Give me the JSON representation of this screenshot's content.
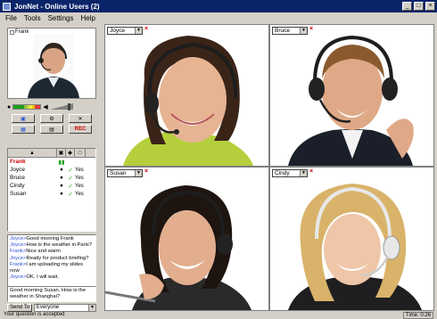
{
  "window": {
    "title": "JonNet - Online Users (2)"
  },
  "menu": [
    "File",
    "Tools",
    "Settings",
    "Help"
  ],
  "self": {
    "name": "Frank"
  },
  "controls": {
    "rec_label": "REC"
  },
  "users": [
    {
      "name": "Frank",
      "yes": ""
    },
    {
      "name": "Joyce",
      "yes": "Yes"
    },
    {
      "name": "Bruce",
      "yes": "Yes"
    },
    {
      "name": "Cindy",
      "yes": "Yes"
    },
    {
      "name": "Susan",
      "yes": "Yes"
    }
  ],
  "chat": [
    {
      "who": "Joyce>",
      "msg": "Good morning Frank"
    },
    {
      "who": "Joyce>",
      "msg": "How is the weather in Paris?"
    },
    {
      "who": "Frank>",
      "msg": "Nice and warm"
    },
    {
      "who": "Joyce>",
      "msg": "Ready for product briefing?"
    },
    {
      "who": "Frank>",
      "msg": "I am uploading my slides now"
    },
    {
      "who": "Joyce>",
      "msg": "OK. I will wait."
    }
  ],
  "chat_input": "Good morning Susan. How is the weather in Shanghai?",
  "send": {
    "label": "Send To",
    "target": "Everyone"
  },
  "videos": [
    {
      "label": "Joyce"
    },
    {
      "label": "Bruce"
    },
    {
      "label": "Susan"
    },
    {
      "label": "Cindy"
    }
  ],
  "status": {
    "left": "Your question is accepted",
    "right": "Time: 0:26"
  },
  "colors": {
    "title_bar": "#0a246a",
    "chrome": "#d4d0c8",
    "accent_red": "#cc0000",
    "ok_green": "#1aa01a"
  }
}
